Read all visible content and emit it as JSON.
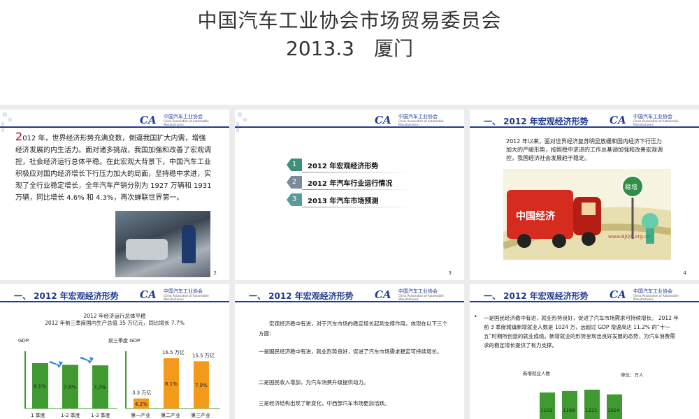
{
  "header": {
    "title": "中国汽车工业协会市场贸易委员会",
    "subtitle": "2013.3　厦门"
  },
  "logo": {
    "mark": "CA",
    "cn": "中国汽车工业协会",
    "en": "China Association of Automobile Manufacturers"
  },
  "slide1": {
    "big_char": "2",
    "text": "012 年，世界经济形势充满变数，倒逼我国扩大内需，增强经济发展的内生活力。面对诸多挑战，我国加强和改善了宏观调控，社会经济运行总体平稳。在此宏观大背景下，中国汽车工业积极应对国内经济增长下行压力加大的局面，坚持稳中求进，实现了全行业稳定增长，全年汽车产销分别为 1927 万辆和 1931 万辆，同比增长 4.6% 和 4.3%，再次蝉联世界第一。",
    "page": "2"
  },
  "slide2": {
    "items": [
      {
        "num": "1",
        "label": "2012 年宏观经济形势",
        "color": "#3e8e7a"
      },
      {
        "num": "2",
        "label": "2012 年汽车行业运行情况",
        "color": "#7a8a9a"
      },
      {
        "num": "3",
        "label": "2013 年汽车市场预测",
        "color": "#5a9a9a"
      }
    ],
    "page": "3"
  },
  "slide3": {
    "section": "一、 2012 年宏观经济形势",
    "intro": "2012 年以来，面对世界经济复苏明显放缓和国内经济下行压力加大的严峻形势，按照稳中求进的工作总基调加强和改善宏观调控，我国经济社会发展趋于稳定。",
    "truck_text": "中国经济",
    "sign_text": "稳增",
    "watermark": "www.BJQX.org.cn",
    "page": "4"
  },
  "slide4": {
    "section": "一、 2012 年宏观经济形势",
    "sub1": "2012 年经济运行总体平稳",
    "sub2": "2012 年前三季度国内生产总值 35 万亿元，同比增长 7.7%",
    "chart_data": [
      {
        "type": "bar",
        "ylabel": "GDP",
        "categories": [
          "1 季度",
          "1-2 季度",
          "1-3 季度"
        ],
        "values": [
          8.1,
          7.8,
          7.7
        ],
        "labels": [
          "8.1%",
          "7.8%",
          "7.7%"
        ],
        "color": "#3f9b2f"
      },
      {
        "type": "bar",
        "ylabel": "前三季度 GDP",
        "categories": [
          "第一产业",
          "第二产业",
          "第三产业"
        ],
        "values": [
          3.3,
          16.5,
          15.5
        ],
        "value_labels": [
          "3.3 万亿",
          "16.5 万亿",
          "15.5 万亿"
        ],
        "growth_labels": [
          "4.2%",
          "8.1%",
          "7.9%"
        ],
        "color": "#f39a1a"
      }
    ]
  },
  "slide5": {
    "section": "一、 2012 年宏观经济形势",
    "p1": "宏观经济稳中有进，对于汽车市场的稳定增长起到支撑作用，体现在以下三个方面：",
    "p2": "一是国民经济稳中有进，就业形势良好，促进了汽车市场需求稳定可持续增长。",
    "p3": "二是国民收入增加，为汽车消费升级提供动力。",
    "p4": "三是经济结构出现了新变化，中西部汽车市场更加活跃。"
  },
  "slide6": {
    "section": "一、 2012 年宏观经济形势",
    "bullet": "•",
    "text": "一是国民经济稳中有进，就业形势良好，促进了汽车市场需求可持续增长。 2012 年前 3 季度城镇新增就业人数是 1024 万，远超过 GDP 增速高达 11.2% 的“十一五”时期所创造的就业成绩。新增就业的形势呈现出良好发展的态势，为汽车消费需求的稳定增长提供了有力支撑。",
    "chart_label": "新增就业人数",
    "unit": "单位：万人",
    "chart_data": {
      "type": "bar",
      "values": [
        1102,
        1168,
        1221,
        1024
      ],
      "labels": [
        "1102",
        "1168",
        "1221",
        "1024"
      ],
      "color": "#3f9b2f"
    }
  }
}
